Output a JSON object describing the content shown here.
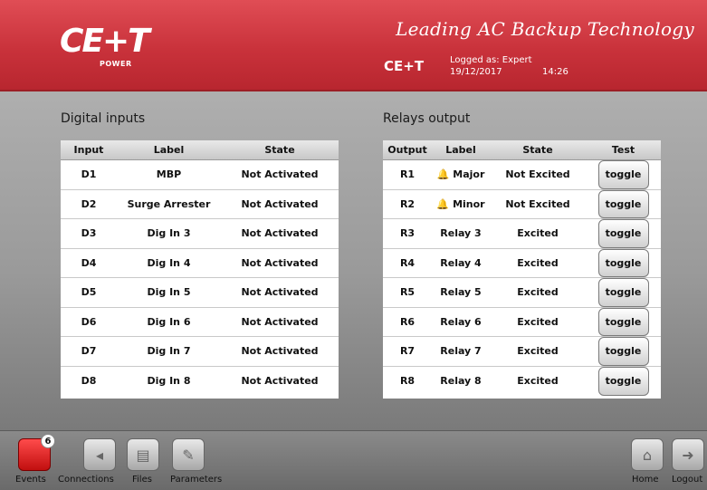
{
  "header": {
    "logo_text": "CE+T",
    "logo_sub": "POWER",
    "tagline": "Leading AC Backup Technology",
    "brand": "CE+T",
    "logged_as": "Logged as: Expert",
    "date": "19/12/2017",
    "time": "14:26"
  },
  "digital_inputs": {
    "title": "Digital inputs",
    "columns": [
      "Input",
      "Label",
      "State"
    ],
    "rows": [
      {
        "input": "D1",
        "label": "MBP",
        "state": "Not Activated"
      },
      {
        "input": "D2",
        "label": "Surge Arrester",
        "state": "Not Activated"
      },
      {
        "input": "D3",
        "label": "Dig In 3",
        "state": "Not Activated"
      },
      {
        "input": "D4",
        "label": "Dig In 4",
        "state": "Not Activated"
      },
      {
        "input": "D5",
        "label": "Dig In 5",
        "state": "Not Activated"
      },
      {
        "input": "D6",
        "label": "Dig In 6",
        "state": "Not Activated"
      },
      {
        "input": "D7",
        "label": "Dig In 7",
        "state": "Not Activated"
      },
      {
        "input": "D8",
        "label": "Dig In 8",
        "state": "Not Activated"
      }
    ]
  },
  "relays_output": {
    "title": "Relays output",
    "columns": [
      "Output",
      "Label",
      "State",
      "Test"
    ],
    "rows": [
      {
        "output": "R1",
        "label": "Major",
        "state": "Not Excited",
        "test": "toggle",
        "icon": "bell-icon"
      },
      {
        "output": "R2",
        "label": "Minor",
        "state": "Not Excited",
        "test": "toggle",
        "icon": "bell-icon"
      },
      {
        "output": "R3",
        "label": "Relay 3",
        "state": "Excited",
        "test": "toggle"
      },
      {
        "output": "R4",
        "label": "Relay 4",
        "state": "Excited",
        "test": "toggle"
      },
      {
        "output": "R5",
        "label": "Relay 5",
        "state": "Excited",
        "test": "toggle"
      },
      {
        "output": "R6",
        "label": "Relay 6",
        "state": "Excited",
        "test": "toggle"
      },
      {
        "output": "R7",
        "label": "Relay 7",
        "state": "Excited",
        "test": "toggle"
      },
      {
        "output": "R8",
        "label": "Relay 8",
        "state": "Excited",
        "test": "toggle"
      }
    ]
  },
  "nav": {
    "events_label": "Events",
    "events_count": "6",
    "connections_label": "Connections",
    "files_label": "Files",
    "parameters_label": "Parameters",
    "home_label": "Home",
    "logout_label": "Logout"
  },
  "colors": {
    "header_red": "#c9323b",
    "events_red": "#e02020"
  }
}
